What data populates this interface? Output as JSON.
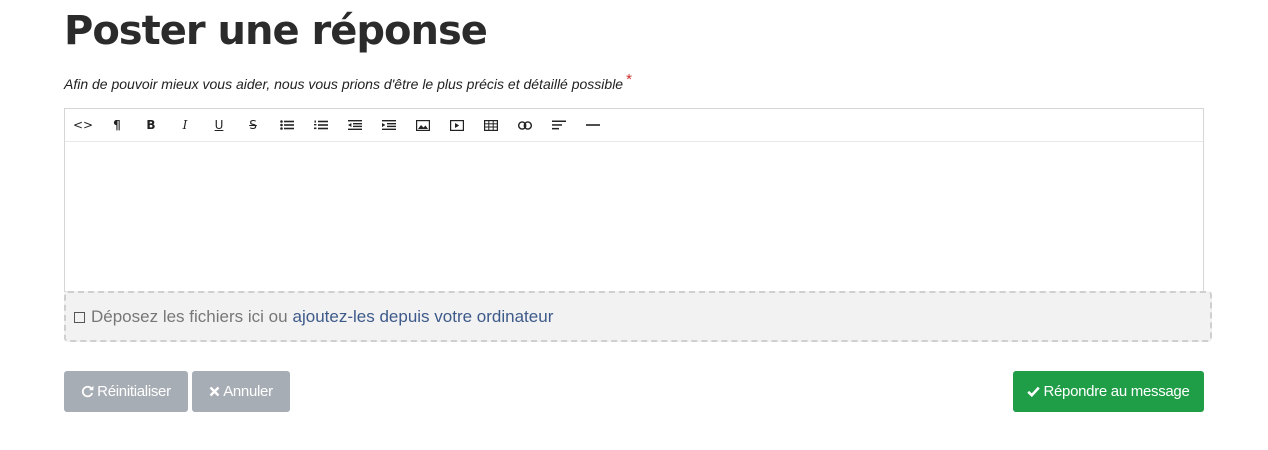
{
  "page": {
    "title": "Poster une réponse",
    "hint": "Afin de pouvoir mieux vous aider, nous vous prions d'être le plus précis et détaillé possible",
    "required_marker": "*"
  },
  "toolbar": {
    "items": [
      {
        "name": "code-view",
        "icon": "code-icon",
        "label": "<>"
      },
      {
        "name": "paragraph",
        "icon": "paragraph-icon",
        "label": "¶"
      },
      {
        "name": "bold",
        "icon": "bold-icon",
        "label": "B"
      },
      {
        "name": "italic",
        "icon": "italic-icon",
        "label": "I"
      },
      {
        "name": "underline",
        "icon": "underline-icon",
        "label": "U"
      },
      {
        "name": "strikethrough",
        "icon": "strikethrough-icon",
        "label": "S"
      },
      {
        "name": "unordered-list",
        "icon": "bullet-list-icon",
        "label": ""
      },
      {
        "name": "ordered-list",
        "icon": "numbered-list-icon",
        "label": ""
      },
      {
        "name": "outdent",
        "icon": "outdent-icon",
        "label": ""
      },
      {
        "name": "indent",
        "icon": "indent-icon",
        "label": ""
      },
      {
        "name": "image",
        "icon": "image-icon",
        "label": ""
      },
      {
        "name": "video",
        "icon": "video-icon",
        "label": ""
      },
      {
        "name": "table",
        "icon": "table-icon",
        "label": ""
      },
      {
        "name": "link",
        "icon": "link-icon",
        "label": ""
      },
      {
        "name": "align",
        "icon": "align-left-icon",
        "label": ""
      },
      {
        "name": "horizontal-rule",
        "icon": "horizontal-rule-icon",
        "label": ""
      }
    ]
  },
  "editor": {
    "content": ""
  },
  "dropzone": {
    "icon": "file-icon",
    "text": "Déposez les fichiers ici ou",
    "link": "ajoutez-les depuis votre ordinateur"
  },
  "actions": {
    "reset": {
      "label": "Réinitialiser",
      "icon": "refresh-icon"
    },
    "cancel": {
      "label": "Annuler",
      "icon": "times-icon"
    },
    "reply": {
      "label": "Répondre au message",
      "icon": "check-icon"
    }
  },
  "colors": {
    "reply_button": "#1f9d47",
    "secondary_button": "#a7adb4",
    "link": "#3d5a8a",
    "required": "#c9302c"
  }
}
